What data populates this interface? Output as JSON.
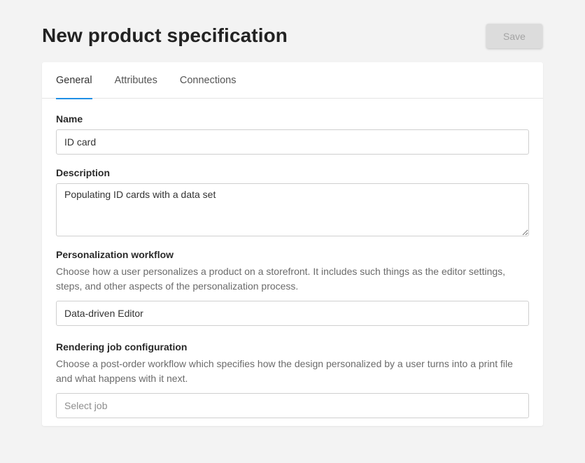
{
  "header": {
    "title": "New product specification",
    "save_label": "Save"
  },
  "tabs": [
    {
      "label": "General",
      "active": true
    },
    {
      "label": "Attributes",
      "active": false
    },
    {
      "label": "Connections",
      "active": false
    }
  ],
  "form": {
    "name": {
      "label": "Name",
      "value": "ID card"
    },
    "description": {
      "label": "Description",
      "value": "Populating ID cards with a data set"
    },
    "personalization_workflow": {
      "label": "Personalization workflow",
      "help": "Choose how a user personalizes a product on a storefront. It includes such things as the editor settings, steps, and other aspects of the personalization process.",
      "value": "Data-driven Editor"
    },
    "rendering_job": {
      "label": "Rendering job configuration",
      "help": "Choose a post-order workflow which specifies how the design personalized by a user turns into a print file and what happens with it next.",
      "value": "",
      "placeholder": "Select job"
    }
  },
  "colors": {
    "accent": "#1f8fe5",
    "background": "#f3f3f3",
    "save_disabled_bg": "#dcdcdc",
    "save_disabled_text": "#a4a4a4"
  }
}
